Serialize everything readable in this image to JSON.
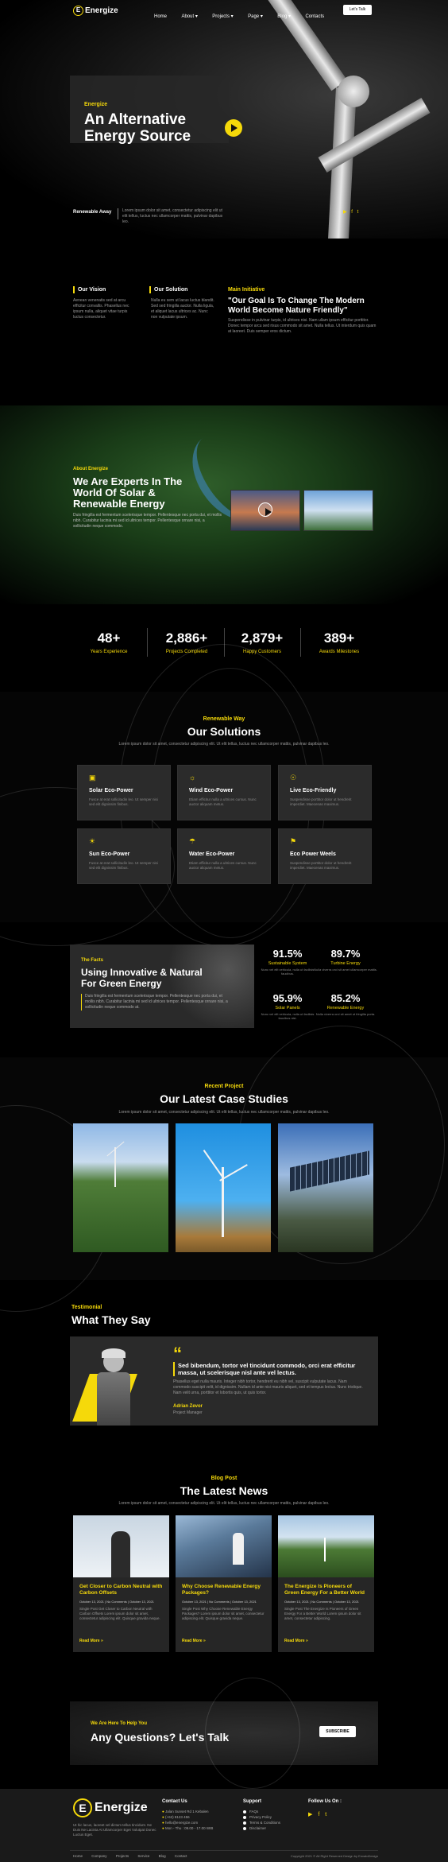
{
  "brand": {
    "name": "Energize",
    "logo_letter": "E"
  },
  "nav": {
    "items": [
      "Home",
      "About",
      "Projects",
      "Page",
      "Blog",
      "Contacts"
    ],
    "cta": "Let's Talk"
  },
  "hero": {
    "eyebrow": "Energize",
    "title_line1": "An Alternative",
    "title_line2": "Energy Source",
    "renewable_label": "Renewable Away",
    "renewable_text": "Lorem ipsum dolor sit amet, consectetur adipiscing elit ut elit tellus, luctus nec ullamcorper mattis, pulvinar dapibus leo."
  },
  "vision": {
    "title": "Our Vision",
    "text": "Aenean venenatis sed at arcu efficitur convallis. Phasellus nec ipsum nulla, aliquet vitae turpis luctus consectetur."
  },
  "solution_col": {
    "title": "Our Solution",
    "text": "Nulla eu sem ut lacus luctus blandit. Sed sed fringilla auctor. Nulla ligula, et aliquet lacus ultrices ac. Nunc non vulputate ipsum."
  },
  "initiative": {
    "label": "Main Initiative",
    "quote": "\"Our Goal Is To Change The Modern World Become Nature Friendly\"",
    "text": "Suspendisse in pulvinar turpis, id ultrices nisi. Nam ullam ipsum efficitur porttitor. Donec tempor arcu sed risus commodo sit amet. Nulla tellus. Ut interdum quis quam at laoreet. Duis semper eros dictum."
  },
  "about": {
    "eyebrow": "About Energize",
    "title_line1": "We Are Experts In The",
    "title_line2": "World Of Solar &",
    "title_line3": "Renewable Energy",
    "text": "Duis fringilla est fermentum scelerisque tempor. Pellentesque nec porta dui, et mollis nibh. Curabitur lacinia mi sed id ultrices tempor. Pellentesque ornare nisi, a sollicitudin neque commodo."
  },
  "stats": [
    {
      "num": "48+",
      "label": "Years Experience"
    },
    {
      "num": "2,886+",
      "label": "Projects Completed"
    },
    {
      "num": "2,879+",
      "label": "Happy Customers"
    },
    {
      "num": "389+",
      "label": "Awards Milestones"
    }
  ],
  "solutions": {
    "eyebrow": "Renewable Way",
    "title": "Our Solutions",
    "intro": "Lorem ipsum dolor sit amet, consectetur adipiscing elit. Ut elit tellus, luctus nec ullamcorper mattis, pulvinar dapibus leo.",
    "cards": [
      {
        "icon": "▣",
        "title": "Solar Eco-Power",
        "text": "Fusce at erat sollicitudin leo. Ut semper nisi sed elit dignissim finibus."
      },
      {
        "icon": "☼",
        "title": "Wind Eco-Power",
        "text": "Etiam efficitur nulla a ultrices cursus. Nunc auctor aliquam metus."
      },
      {
        "icon": "☉",
        "title": "Live Eco-Friendly",
        "text": "Suspendisse porttitor dolor ut hendrerit imperdiet. Maecenas maximus."
      },
      {
        "icon": "☀",
        "title": "Sun Eco-Power",
        "text": "Fusce at erat sollicitudin leo. Ut semper nisi sed elit dignissim finibus."
      },
      {
        "icon": "☂",
        "title": "Water Eco-Power",
        "text": "Etiam efficitur nulla a ultrices cursus. Nunc auctor aliquam metus."
      },
      {
        "icon": "⚑",
        "title": "Eco Power Weels",
        "text": "Suspendisse porttitor dolor ut hendrerit imperdiet. Maecenas maximus."
      }
    ]
  },
  "facts": {
    "eyebrow": "The Facts",
    "title_line1": "Using Innovative & Natural",
    "title_line2": "For Green Energy",
    "text": "Duis fringilla est fermentum scelerisque tempor. Pellentesque nec porta dui, et mollis nibh. Curabitur lacinia mi sed id ultrices tempor. Pellentesque ornare nisi, a sollicitudin neque commodo at.",
    "items": [
      {
        "num": "91.5%",
        "label": "Sustainable System",
        "text": "Nunc vel elit vehicula, nulla ut facilisis faucibus."
      },
      {
        "num": "89.7%",
        "label": "Turbine Energy",
        "text": "Nulla viverra orci sit amet ullamcorper mattis."
      },
      {
        "num": "95.9%",
        "label": "Solar Panels",
        "text": "Nunc vel elit vehicula, nulla ut facilisis faucibus nisi."
      },
      {
        "num": "85.2%",
        "label": "Renewable Energy",
        "text": "Nulla viverra orci sit amet ut fringilla porta."
      }
    ]
  },
  "cases": {
    "eyebrow": "Recent Project",
    "title": "Our Latest Case Studies",
    "intro": "Lorem ipsum dolor sit amet, consectetur adipiscing elit. Ut elit tellus, luctus nec ullamcorper mattis, pulvinar dapibus leo."
  },
  "testimonial": {
    "eyebrow": "Testimonial",
    "title": "What They Say",
    "quote_mark": "“",
    "headline": "Sed bibendum, tortor vel tincidunt commodo, orci erat efficitur massa, ut scelerisque nisl ante vel lectus.",
    "text": "Phasellus eget nulla mauris. Integer nibh tortor, hendrerit eu nibh vel, suscipit vulputate lacus. Nam commodo suscipit velit, id dignissim. Nullam id ante nisi mauris aliquet, sed et tempus lectus. Nunc tristique. Nam velit urna, porttitor et lobortis quis, ut quis tortor.",
    "name": "Adrian Zevor",
    "role": "Project Manager"
  },
  "blog": {
    "eyebrow": "Blog Post",
    "title": "The Latest News",
    "intro": "Lorem ipsum dolor sit amet, consectetur adipiscing elit. Ut elit tellus, luctus nec ullamcorper mattis, pulvinar dapibus leo.",
    "posts": [
      {
        "title": "Get Closer to Carbon Neutral with Carbon Offsets",
        "meta": "October 13, 2021 | No Comments | October 13, 2021",
        "text": "Single Post Get Closer to Carbon Neutral with Carbon Offsets Lorem ipsum dolor sit amet, consectetur adipiscing elit. Quisque gravida neque.",
        "link": "Read More »"
      },
      {
        "title": "Why Choose Renewable Energy Packages?",
        "meta": "October 13, 2021 | No Comments | October 13, 2021",
        "text": "Single Post Why Choose Renewable Energy Packages? Lorem ipsum dolor sit amet, consectetur adipiscing elit. Quisque gravida neque.",
        "link": "Read More »"
      },
      {
        "title": "The Energize Is Pioneers of Green Energy For a Better World",
        "meta": "October 13, 2021 | No Comments | October 13, 2021",
        "text": "Single Post The Energize Is Pioneers of Green Energy For a Better World Lorem ipsum dolor sit amet, consectetur adipiscing.",
        "link": "Read More »"
      }
    ]
  },
  "cta": {
    "eyebrow": "We Are Here To Help You",
    "title": "Any Questions? Let's Talk",
    "button": "SUBSCRIBE"
  },
  "footer": {
    "about": "Ut hic lacus, laoreet vel dictum tellus tincidunt. Ne Duis Ne Lacinia At Ullamcorper Eget Volutpat Donec Luctus Eget.",
    "contact_title": "Contact Us",
    "contact": [
      "Jalan Sunset Rd 1 Kebalen",
      "(+62) 8123 456",
      "hello@energize.com",
      "Mon - Thu : 09.00 - 17.00 WIB"
    ],
    "support_title": "Support",
    "support": [
      "FAQs",
      "Privacy Policy",
      "Terms & Conditions",
      "Disclaimer"
    ],
    "follow_title": "Follow Us On :",
    "social": [
      "▶",
      "f",
      "t"
    ],
    "bottom_links": [
      "Home",
      "Company",
      "Projects",
      "Service",
      "Blog",
      "Contact"
    ],
    "copyright": "Copyright 2021 © All Right Reserved Design by EnvatoDesign"
  },
  "colors": {
    "accent": "#f5d90a",
    "bg": "#000000",
    "card": "#2a2a2a"
  }
}
